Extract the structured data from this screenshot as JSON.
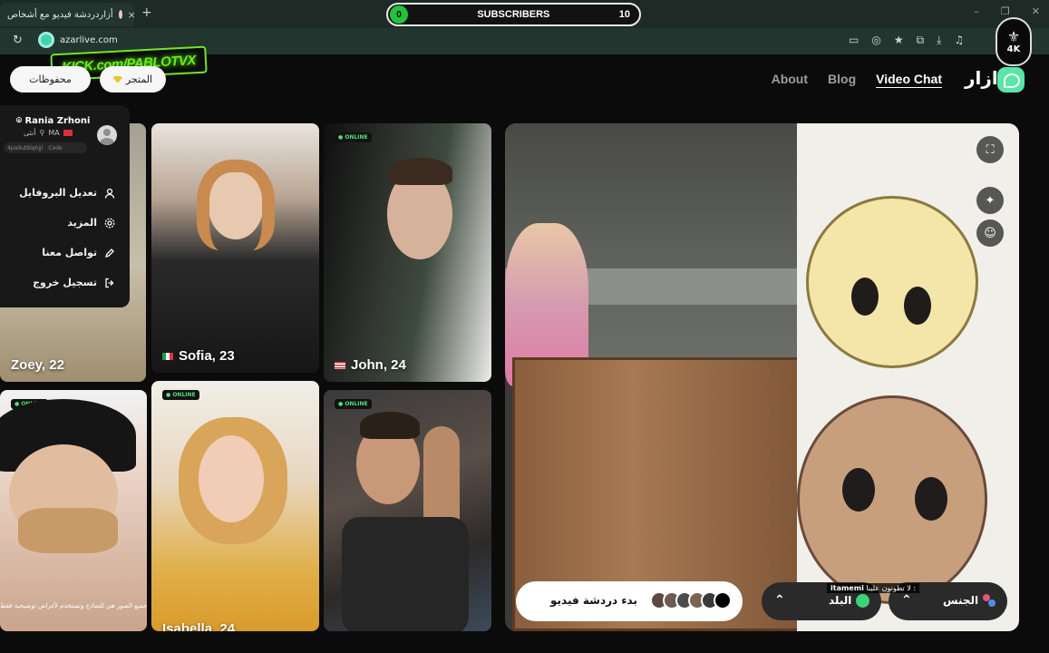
{
  "browser": {
    "tab_title": "أزاردردشة فيديو مع أشخاص",
    "url": "azarlive.com",
    "new_tab": "+",
    "close": "×",
    "reload": "↻",
    "window_controls": [
      "–",
      "❐",
      "✕"
    ],
    "toolbar_icons": [
      "cast-icon",
      "eye-off-icon",
      "star-icon",
      "extension-icon",
      "download-icon",
      "media-icon",
      "more-icon"
    ]
  },
  "overlay": {
    "subscribers_label": "SUBSCRIBERS",
    "subscribers_left": "0",
    "subscribers_right": "10",
    "kick_text": "KICK.com/PABLOTVX",
    "logo_text": "4K"
  },
  "header": {
    "saved_pill": "محفوظات",
    "store_pill": "المتجر",
    "nav": [
      {
        "label": "About",
        "active": false
      },
      {
        "label": "Blog",
        "active": false
      },
      {
        "label": "Video Chat",
        "active": true
      }
    ],
    "brand": "ازار"
  },
  "profile_menu": {
    "name": "Rania Zrhoni",
    "country": "MA",
    "gender": "أنثى",
    "code_value": "4pa9utblqhjjl",
    "code_label": "Code",
    "items": [
      {
        "label": "تعديل البروفايل",
        "icon": "user-icon"
      },
      {
        "label": "المزيد",
        "icon": "gear-icon"
      },
      {
        "label": "تواصل معنا",
        "icon": "pencil-icon"
      },
      {
        "label": "تسجيل خروج",
        "icon": "logout-icon"
      }
    ]
  },
  "cards": [
    {
      "name": "Zoey, 22",
      "online": false
    },
    {
      "name": "Sofia, 23",
      "online": false,
      "flag": "italy"
    },
    {
      "name": "John, 24",
      "online": true,
      "flag": "us"
    },
    {
      "name": "",
      "online": true
    },
    {
      "name": "Isabella, 24",
      "online": true
    },
    {
      "name": "",
      "online": true
    }
  ],
  "online_badge": "ONLINE",
  "disclaimer": "جميع الصور هي للنماذج وتستخدم لأغراض توضيحية فقط",
  "video": {
    "start_label": "بدء دردشة فيديو",
    "country_label": "البلد",
    "gender_label": "الجنس",
    "caption_user": "itamemi",
    "caption_text": "لا تطونون علينا :"
  },
  "colors": {
    "accent": "#59e6a8",
    "online": "#4fe07a",
    "kick": "#6ee924"
  }
}
